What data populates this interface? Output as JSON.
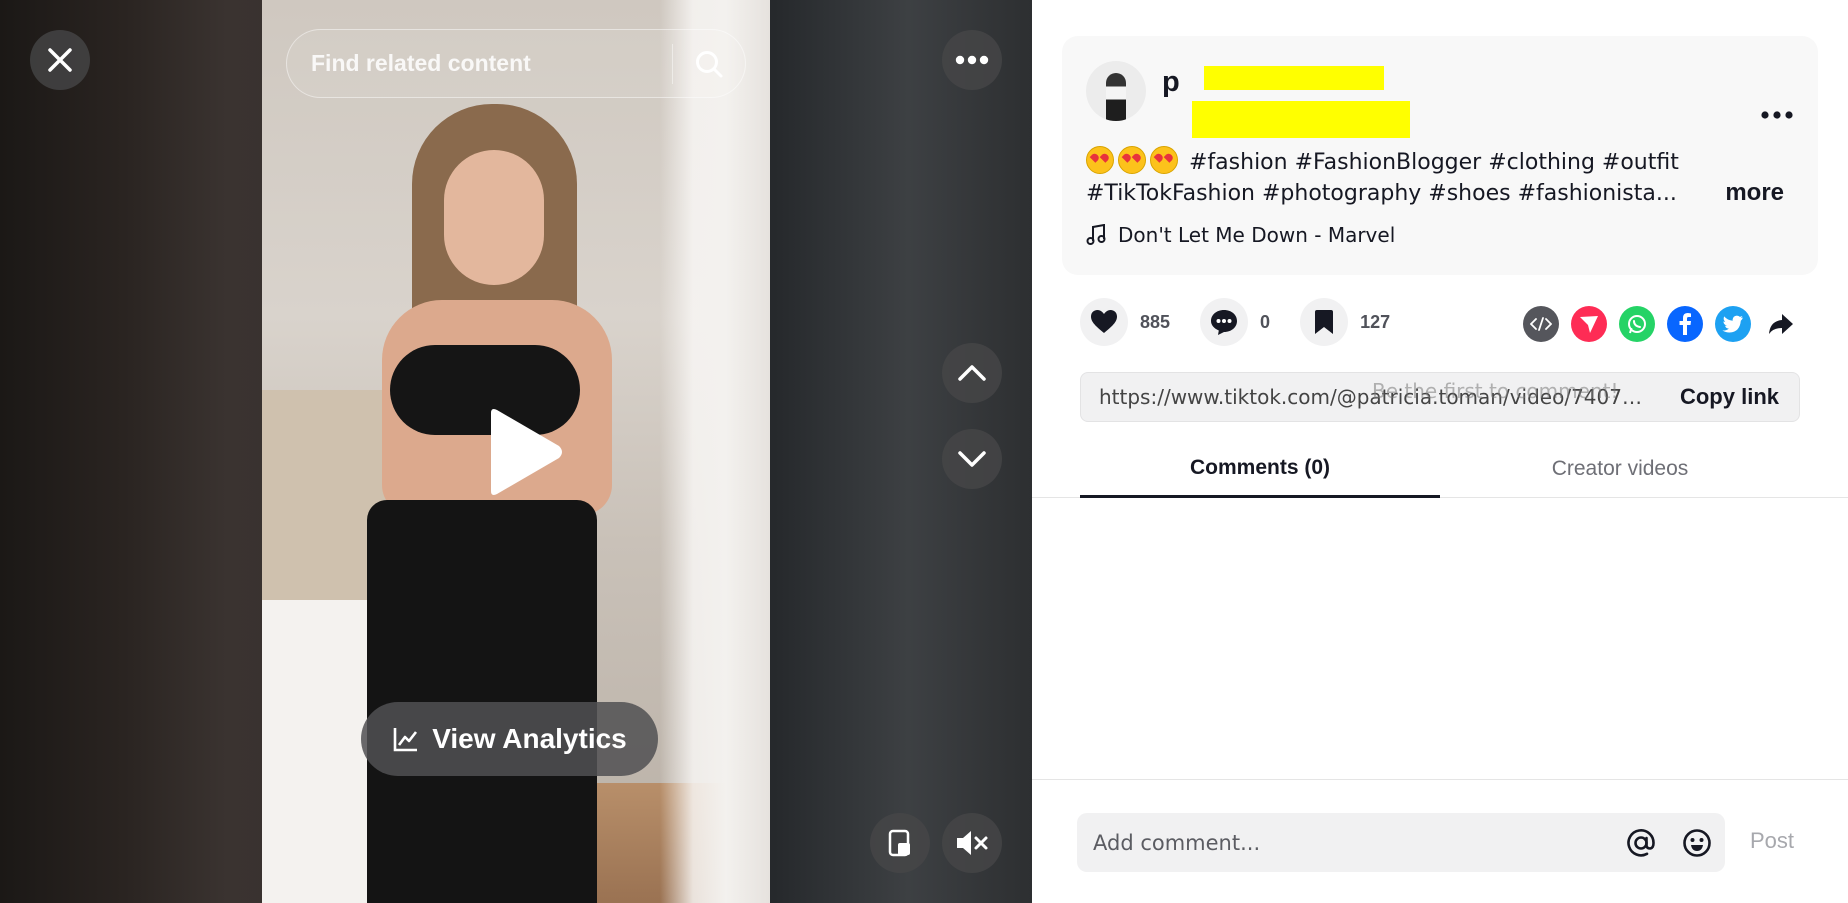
{
  "video": {
    "search": {
      "placeholder": "Find related content"
    },
    "analytics_label": "View Analytics",
    "icons": {
      "close": "close-icon",
      "search": "search-icon",
      "more": "more-icon",
      "up": "chevron-up-icon",
      "down": "chevron-down-icon",
      "play": "play-icon",
      "analytics": "chart-line-icon",
      "mini_player": "mini-player-icon",
      "mute": "volume-muted-icon"
    }
  },
  "post": {
    "author_initial": "p",
    "description_line1": "#fashion #FashionBlogger #clothing #outfit",
    "description_line2": "#TikTokFashion #photography #shoes #fashionista...",
    "emoji_count": 3,
    "more_label": "more",
    "music": "Don't Let Me Down - Marvel",
    "stats": {
      "likes": "885",
      "comments": "0",
      "saves": "127"
    },
    "link": "https://www.tiktok.com/@patricia.toman/video/740778...",
    "copy_label": "Copy link",
    "empty_hint": "Be the first to comment!"
  },
  "share_icons": [
    {
      "name": "embed-icon",
      "color": "#55565c"
    },
    {
      "name": "send-icon",
      "color": "#fe2c55"
    },
    {
      "name": "whatsapp-icon",
      "color": "#25d366"
    },
    {
      "name": "facebook-icon",
      "color": "#0866ff"
    },
    {
      "name": "twitter-icon",
      "color": "#1da1f2"
    },
    {
      "name": "share-arrow-icon",
      "color": "#161823"
    }
  ],
  "tabs": [
    {
      "label": "Comments (0)",
      "active": true
    },
    {
      "label": "Creator videos",
      "active": false
    }
  ],
  "comment": {
    "placeholder": "Add comment...",
    "post_label": "Post"
  },
  "colors": {
    "accent": "#fe2c55",
    "redaction": "#ffff00",
    "text": "#161823"
  }
}
